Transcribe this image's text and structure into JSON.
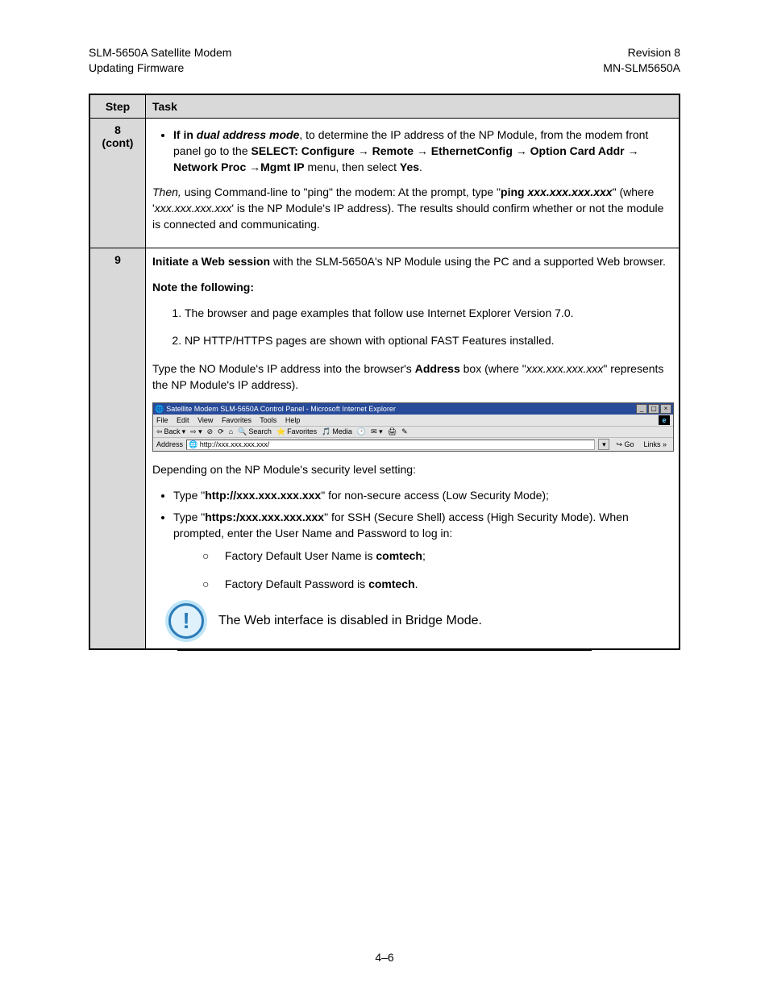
{
  "header": {
    "left_line1": "SLM-5650A Satellite Modem",
    "left_line2": "Updating Firmware",
    "right_line1": "Revision 8",
    "right_line2": "MN-SLM5650A"
  },
  "table": {
    "head_step": "Step",
    "head_task": "Task",
    "row8": {
      "num": "8\n(cont)",
      "bullet_prefix": "If in ",
      "bullet_em": "dual address mode",
      "bullet_mid": ", to determine the IP address of the NP Module, from the modem front panel go to the ",
      "menu_path": "SELECT: Configure → Remote → EthernetConfig → Option Card Addr → Network Proc →Mgmt IP",
      "bullet_suffix1": " menu, then select ",
      "bullet_yes": "Yes",
      "bullet_suffix2": ".",
      "p2_em": "Then,",
      "p2_a": " using Command-line to \"ping\" the modem: At the prompt, type \"",
      "p2_cmd": "ping xxx.xxx.xxx.xxx",
      "p2_b": "\" (where '",
      "p2_ip": "xxx.xxx.xxx.xxx",
      "p2_c": "' is the NP Module's IP address). The results should confirm whether or not the module is connected and communicating."
    },
    "row9": {
      "num": "9",
      "intro_b": "Initiate a Web session",
      "intro_rest": " with the SLM-5650A's NP Module using the PC and a supported Web browser.",
      "note_heading": "Note the following:",
      "note1": "The browser and page examples that follow use Internet Explorer Version 7.0.",
      "note2": "NP HTTP/HTTPS pages are shown with optional FAST Features installed.",
      "addr_a": "Type the NO Module's IP address into the browser's ",
      "addr_b": "Address",
      "addr_c": " box (where \"",
      "addr_ip": "xxx.xxx.xxx.xxx",
      "addr_d": "\" represents the NP Module's IP address).",
      "ie": {
        "title": "Satellite Modem SLM-5650A Control Panel - Microsoft Internet Explorer",
        "menu": [
          "File",
          "Edit",
          "View",
          "Favorites",
          "Tools",
          "Help"
        ],
        "back": "Back",
        "search": "Search",
        "favorites": "Favorites",
        "media": "Media",
        "addr_label": "Address",
        "url": "http://xxx.xxx.xxx.xxx/",
        "go": "Go",
        "links": "Links"
      },
      "dep": "Depending on the NP Module's security level setting:",
      "b1_a": "Type \"",
      "b1_url": "http://xxx.xxx.xxx.xxx",
      "b1_b": "\"  for non-secure access (Low Security Mode);",
      "b2_a": "Type \"",
      "b2_url": "https:/xxx.xxx.xxx.xxx",
      "b2_b": "\"  for SSH (Secure Shell) access (High Security Mode). When prompted, enter the User Name and Password to log in:",
      "s1_a": "Factory Default User Name is ",
      "s1_b": "comtech",
      "s1_c": ";",
      "s2_a": "Factory Default Password is ",
      "s2_b": "comtech",
      "s2_c": ".",
      "alert": "The Web interface is disabled in Bridge Mode."
    }
  },
  "footer": {
    "page": "4–6"
  }
}
